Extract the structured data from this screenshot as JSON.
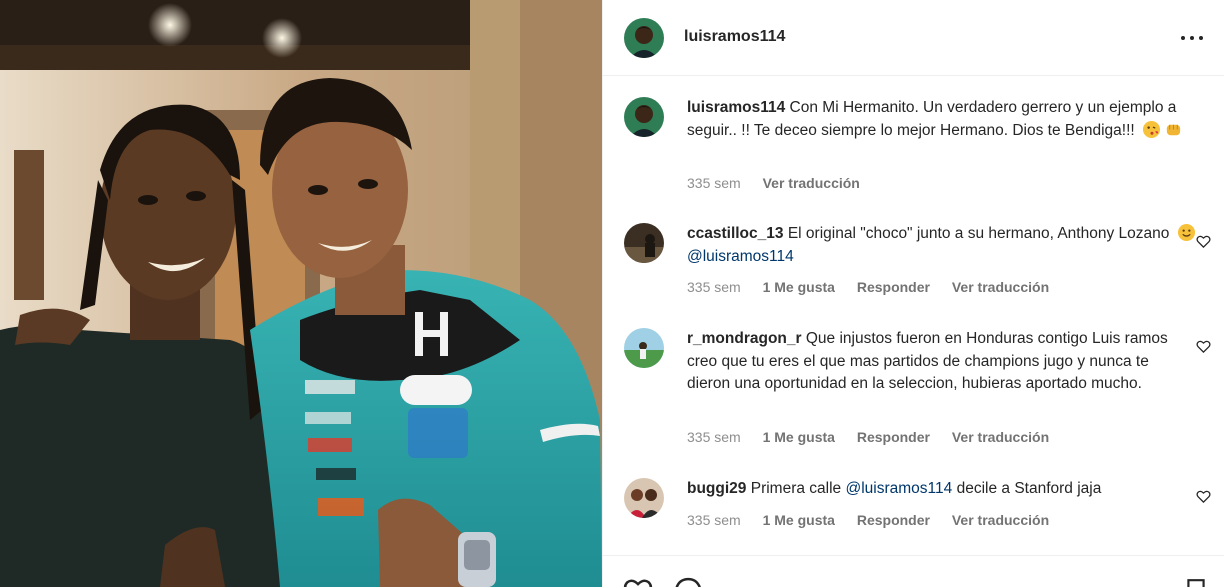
{
  "post": {
    "username": "luisramos114",
    "photo_alt": "Two men posing together, giving a thumbs up"
  },
  "caption": {
    "username": "luisramos114",
    "text": "Con Mi Hermanito. Un verdadero gerrero y un ejemplo a seguir.. !! Te deceo siempre lo mejor Hermano. Dios te Bendiga!!!",
    "emojis": [
      "kiss-face-emoji",
      "fist-bump-emoji"
    ],
    "time": "335 sem",
    "translate": "Ver traducción"
  },
  "comments": [
    {
      "username": "ccastilloc_13",
      "text": "El original \"choco\" junto a su hermano, Anthony Lozano",
      "emoji": "smile-face-emoji",
      "mention": "@luisramos114",
      "time": "335 sem",
      "likes": "1 Me gusta",
      "reply": "Responder",
      "translate": "Ver traducción"
    },
    {
      "username": "r_mondragon_r",
      "text": "Que injustos fueron en Honduras contigo Luis ramos creo que tu eres el que mas partidos de champions jugo y nunca te dieron una oportunidad en la seleccion, hubieras aportado mucho.",
      "time": "335 sem",
      "likes": "1 Me gusta",
      "reply": "Responder",
      "translate": "Ver traducción"
    },
    {
      "username": "buggi29",
      "text_before": "Primera calle",
      "mention": "@luisramos114",
      "text_after": "decile a Stanford jaja",
      "time": "335 sem",
      "likes": "1 Me gusta",
      "reply": "Responder",
      "translate": "Ver traducción"
    }
  ],
  "icons": {
    "more": "more-options-icon",
    "heart": "heart-icon",
    "comment": "comment-icon",
    "save": "bookmark-icon"
  },
  "colors": {
    "text": "#262626",
    "secondary": "#8e8e8e",
    "mention": "#00376b",
    "divider": "#efefef"
  }
}
